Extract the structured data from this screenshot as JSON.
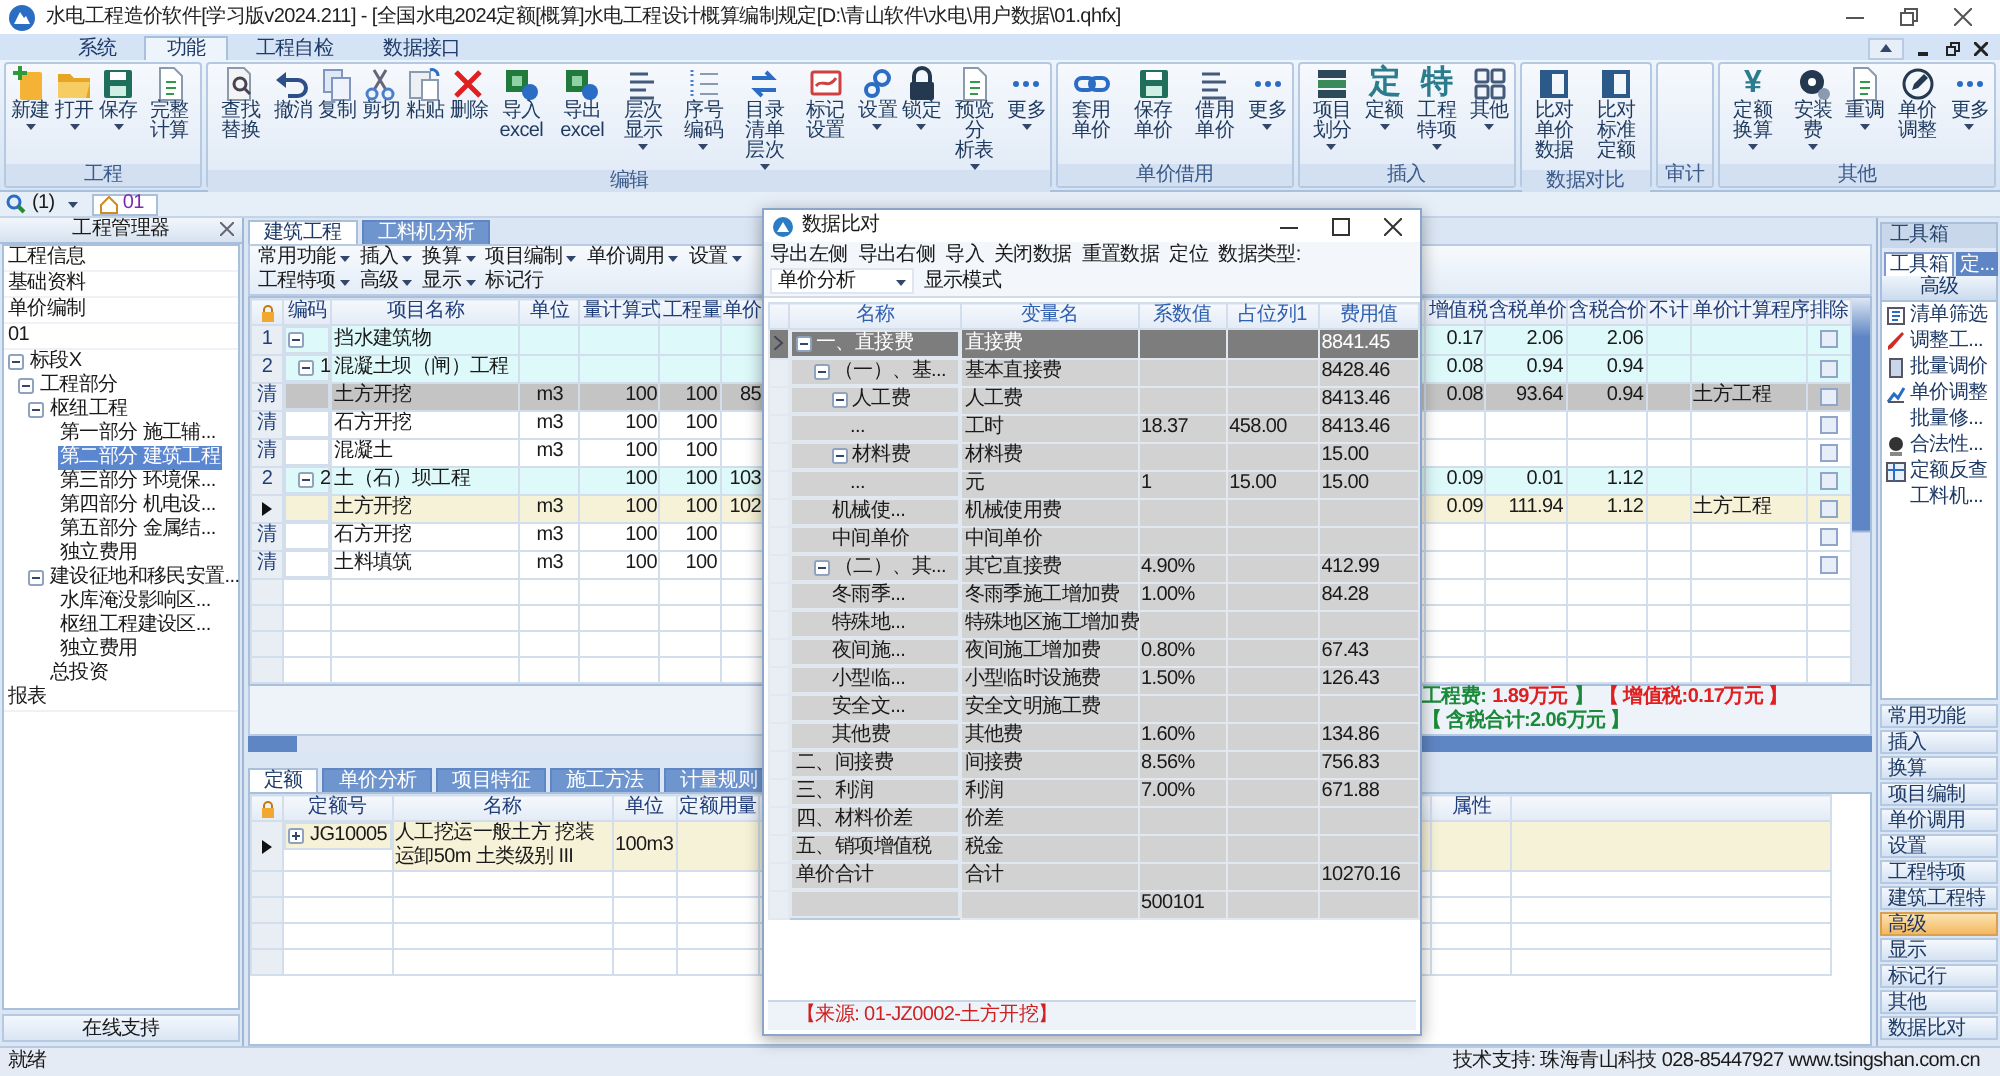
{
  "window": {
    "title": "水电工程造价软件[学习版v2024.211] - [全国水电2024定额[概算]水电工程设计概算编制规定[D:\\青山软件\\水电\\用户数据\\01.qhfx]"
  },
  "menu_tabs": [
    {
      "label": "系统",
      "selected": false
    },
    {
      "label": "功能",
      "selected": true
    },
    {
      "label": "工程自检",
      "selected": false
    },
    {
      "label": "数据接口",
      "selected": false
    }
  ],
  "ribbon_groups": [
    {
      "title": "工程",
      "buttons": [
        {
          "label": "新建",
          "dropdown": true
        },
        {
          "label": "打开",
          "dropdown": true
        },
        {
          "label": "保存",
          "dropdown": true
        },
        {
          "label": "完整计算",
          "dropdown": false
        }
      ]
    },
    {
      "title": "编辑",
      "buttons": [
        {
          "label": "查找替换",
          "dropdown": false
        },
        {
          "label": "撤消",
          "dropdown": false
        },
        {
          "label": "复制",
          "dropdown": false
        },
        {
          "label": "剪切",
          "dropdown": false
        },
        {
          "label": "粘贴",
          "dropdown": false
        },
        {
          "label": "删除",
          "dropdown": false
        },
        {
          "label": "导入excel",
          "dropdown": false
        },
        {
          "label": "导出excel",
          "dropdown": false
        },
        {
          "label": "层次显示",
          "dropdown": true
        },
        {
          "label": "序号编码",
          "dropdown": true
        },
        {
          "label": "目录清单层次",
          "dropdown": true
        },
        {
          "label": "标记设置",
          "dropdown": false
        },
        {
          "label": "设置",
          "dropdown": true
        },
        {
          "label": "锁定",
          "dropdown": true
        },
        {
          "label": "预览分析表",
          "dropdown": true
        },
        {
          "label": "更多",
          "dropdown": true
        }
      ]
    },
    {
      "title": "单价借用",
      "buttons": [
        {
          "label": "套用单价",
          "dropdown": false
        },
        {
          "label": "保存单价",
          "dropdown": false
        },
        {
          "label": "借用单价",
          "dropdown": false
        },
        {
          "label": "更多",
          "dropdown": true
        }
      ]
    },
    {
      "title": "插入",
      "buttons": [
        {
          "label": "项目划分",
          "dropdown": true
        },
        {
          "label": "定额",
          "dropdown": true,
          "glyph": "定"
        },
        {
          "label": "工程特项",
          "dropdown": true,
          "glyph": "特"
        },
        {
          "label": "其他",
          "dropdown": true
        }
      ]
    },
    {
      "title": "数据对比",
      "buttons": [
        {
          "label": "比对单价数据",
          "dropdown": false
        },
        {
          "label": "比对标准定额",
          "dropdown": false
        }
      ]
    },
    {
      "title": "审计"
    },
    {
      "title": "其他",
      "buttons": [
        {
          "label": "定额换算",
          "dropdown": true,
          "glyph": "¥"
        },
        {
          "label": "安装费",
          "dropdown": true
        },
        {
          "label": "重调",
          "dropdown": true
        },
        {
          "label": "单价调整",
          "dropdown": false
        },
        {
          "label": "更多",
          "dropdown": true
        }
      ]
    }
  ],
  "doc_tabs": {
    "search_count": "(1)",
    "tabs": [
      {
        "label": "01",
        "selected": true
      }
    ]
  },
  "manager": {
    "title": "工程管理器",
    "items": [
      {
        "label": "工程信息"
      },
      {
        "label": "基础资料"
      },
      {
        "label": "单价编制"
      },
      {
        "label": "01"
      }
    ],
    "tree": [
      {
        "label": "标段X",
        "selected": false,
        "expanded": true,
        "children": [
          {
            "label": "工程部分",
            "selected": false,
            "expanded": true,
            "children": [
              {
                "label": "枢纽工程",
                "selected": false,
                "expanded": true,
                "children": [
                  {
                    "label": "第一部分 施工辅...",
                    "selected": false
                  },
                  {
                    "label": "第二部分 建筑工程",
                    "selected": true
                  },
                  {
                    "label": "第三部分 环境保...",
                    "selected": false
                  },
                  {
                    "label": "第四部分 机电设...",
                    "selected": false
                  },
                  {
                    "label": "第五部分 金属结...",
                    "selected": false
                  },
                  {
                    "label": "独立费用",
                    "selected": false
                  }
                ]
              },
              {
                "label": "建设征地和移民安置...",
                "selected": false,
                "expanded": true,
                "children": [
                  {
                    "label": "水库淹没影响区...",
                    "selected": false
                  },
                  {
                    "label": "枢纽工程建设区...",
                    "selected": false
                  },
                  {
                    "label": "独立费用",
                    "selected": false
                  }
                ]
              },
              {
                "label": "总投资",
                "selected": false
              }
            ]
          }
        ]
      }
    ],
    "footer_items": [
      {
        "label": "报表"
      }
    ],
    "support_button": "在线支持"
  },
  "center": {
    "tabs": [
      {
        "label": "建筑工程",
        "selected": true
      },
      {
        "label": "工料机分析",
        "selected": false
      }
    ],
    "toolbar": [
      {
        "label": "常用功能",
        "dropdown": true
      },
      {
        "label": "插入",
        "dropdown": true
      },
      {
        "label": "换算",
        "dropdown": true
      },
      {
        "label": "项目编制",
        "dropdown": true
      },
      {
        "label": "单价调用",
        "dropdown": true
      },
      {
        "label": "设置",
        "dropdown": true
      },
      {
        "label": "工程特项",
        "dropdown": true
      },
      {
        "label": "高级",
        "dropdown": true
      },
      {
        "label": "显示",
        "dropdown": true
      },
      {
        "label": "标记行",
        "dropdown": false
      }
    ],
    "table": {
      "columns": [
        "编码",
        "项目名称",
        "单位",
        "量计算式",
        "工程量",
        "单价",
        "增值税",
        "含税单价",
        "含税合价",
        "不计",
        "单价计算程序",
        "排除"
      ],
      "rows": [
        {
          "head": "1",
          "name": "挡水建筑物",
          "vat": "0.17",
          "tax_unit": "2.06",
          "tax_total": "2.06",
          "selected": false,
          "current": false,
          "excluded": false,
          "expanded": true,
          "children": [
            {
              "head": "2",
              "code": "1",
              "name": "混凝土坝（闸）工程",
              "vat": "0.08",
              "tax_unit": "0.94",
              "tax_total": "0.94",
              "selected": false,
              "current": false,
              "excluded": false,
              "expanded": true,
              "children": [
                {
                  "head": "清",
                  "name": "土方开挖",
                  "unit": "m3",
                  "formula": "100",
                  "qty": "100",
                  "price": "85",
                  "vat": "0.08",
                  "tax_unit": "93.64",
                  "tax_total": "0.94",
                  "program": "土方工程",
                  "selected": true,
                  "current": false,
                  "excluded": false
                },
                {
                  "head": "清",
                  "name": "石方开挖",
                  "unit": "m3",
                  "formula": "100",
                  "qty": "100",
                  "selected": false,
                  "current": false,
                  "excluded": false
                },
                {
                  "head": "清",
                  "name": "混凝土",
                  "unit": "m3",
                  "formula": "100",
                  "qty": "100",
                  "selected": false,
                  "current": false,
                  "excluded": false
                }
              ]
            },
            {
              "head": "2",
              "code": "2",
              "name": "土（石）坝工程",
              "formula": "100",
              "qty": "100",
              "price": "103",
              "vat": "0.09",
              "tax_unit": "0.01",
              "tax_total": "1.12",
              "selected": false,
              "current": false,
              "excluded": false,
              "expanded": true,
              "children": [
                {
                  "name": "土方开挖",
                  "unit": "m3",
                  "formula": "100",
                  "qty": "100",
                  "price": "102",
                  "vat": "0.09",
                  "tax_unit": "111.94",
                  "tax_total": "1.12",
                  "program": "土方工程",
                  "selected": false,
                  "current": true,
                  "excluded": false
                },
                {
                  "head": "清",
                  "name": "石方开挖",
                  "unit": "m3",
                  "formula": "100",
                  "qty": "100",
                  "selected": false,
                  "current": false,
                  "excluded": false
                },
                {
                  "head": "清",
                  "name": "土料填筑",
                  "unit": "m3",
                  "formula": "100",
                  "qty": "100",
                  "selected": false,
                  "current": false,
                  "excluded": false
                }
              ]
            }
          ]
        }
      ]
    },
    "summary": [
      {
        "text": "工程费:",
        "color": "#1a8a3a"
      },
      {
        "text": "1.89万元",
        "color": "#e02020"
      },
      {
        "text": "】",
        "color": "#1a8a3a"
      },
      {
        "text": "【 增值税:0.17万元 】",
        "color": "#e02020"
      },
      {
        "text": "【 含税合计:2.06万元 】",
        "color": "#1a8a3a"
      }
    ]
  },
  "bottom": {
    "tabs": [
      {
        "label": "定额",
        "selected": true
      },
      {
        "label": "单价分析",
        "selected": false
      },
      {
        "label": "项目特征",
        "selected": false
      },
      {
        "label": "施工方法",
        "selected": false
      },
      {
        "label": "计量规则",
        "selected": false
      }
    ],
    "table": {
      "columns": [
        "定额号",
        "名称",
        "单位",
        "定额用量",
        "属性"
      ],
      "rows": [
        {
          "code": "JG10005",
          "name": "人工挖运一般土方 挖装运卸50m 土类级别 III",
          "unit": "100m3",
          "current": true,
          "expanded": false
        }
      ]
    }
  },
  "toolbox": {
    "title": "工具箱",
    "tabs": [
      {
        "label": "工具箱",
        "selected": true
      },
      {
        "label": "定...",
        "selected": false
      }
    ],
    "section": "高级",
    "items": [
      "清单筛选",
      "调整工...",
      "批量调价",
      "单价调整",
      "批量修...",
      "合法性...",
      "定额反查",
      "工料机..."
    ],
    "panels": [
      {
        "label": "常用功能",
        "selected": false
      },
      {
        "label": "插入",
        "selected": false
      },
      {
        "label": "换算",
        "selected": false
      },
      {
        "label": "项目编制",
        "selected": false
      },
      {
        "label": "单价调用",
        "selected": false
      },
      {
        "label": "设置",
        "selected": false
      },
      {
        "label": "工程特项",
        "selected": false
      },
      {
        "label": "建筑工程特",
        "selected": false
      },
      {
        "label": "高级",
        "selected": true
      },
      {
        "label": "显示",
        "selected": false
      },
      {
        "label": "标记行",
        "selected": false
      },
      {
        "label": "其他",
        "selected": false
      },
      {
        "label": "数据比对",
        "selected": false
      }
    ]
  },
  "dialog": {
    "title": "数据比对",
    "toolbar": [
      "导出左侧",
      "导出右侧",
      "导入",
      "关闭数据",
      "重置数据",
      "定位"
    ],
    "type_label": "数据类型:",
    "type_value": "单价分析",
    "mode_label": "显示模式",
    "columns": [
      "名称",
      "变量名",
      "系数值",
      "占位列1",
      "费用值"
    ],
    "rows": [
      {
        "name": "一、直接费",
        "var": "直接费",
        "fee": "8841.45",
        "selected": true,
        "expanded": true,
        "children": [
          {
            "name": "（一）、基...",
            "var": "基本直接费",
            "fee": "8428.46",
            "selected": false,
            "expanded": true,
            "children": [
              {
                "name": "人工费",
                "var": "人工费",
                "fee": "8413.46",
                "selected": false,
                "expanded": true,
                "children": [
                  {
                    "name": "...",
                    "var": "工时",
                    "coef": "18.37",
                    "occ": "458.00",
                    "fee": "8413.46",
                    "selected": false
                  }
                ]
              },
              {
                "name": "材料费",
                "var": "材料费",
                "fee": "15.00",
                "selected": false,
                "expanded": true,
                "children": [
                  {
                    "name": "...",
                    "var": "元",
                    "coef": "1",
                    "occ": "15.00",
                    "fee": "15.00",
                    "selected": false
                  }
                ]
              },
              {
                "name": "机械使...",
                "var": "机械使用费",
                "selected": false
              },
              {
                "name": "中间单价",
                "var": "中间单价",
                "selected": false
              }
            ]
          },
          {
            "name": "（二）、其...",
            "var": "其它直接费",
            "coef": "4.90%",
            "fee": "412.99",
            "selected": false,
            "expanded": true,
            "children": [
              {
                "name": "冬雨季...",
                "var": "冬雨季施工增加费",
                "coef": "1.00%",
                "fee": "84.28",
                "selected": false
              },
              {
                "name": "特殊地...",
                "var": "特殊地区施工增加费",
                "selected": false
              },
              {
                "name": "夜间施...",
                "var": "夜间施工增加费",
                "coef": "0.80%",
                "fee": "67.43",
                "selected": false
              },
              {
                "name": "小型临...",
                "var": "小型临时设施费",
                "coef": "1.50%",
                "fee": "126.43",
                "selected": false
              },
              {
                "name": "安全文...",
                "var": "安全文明施工费",
                "selected": false
              },
              {
                "name": "其他费",
                "var": "其他费",
                "coef": "1.60%",
                "fee": "134.86",
                "selected": false
              }
            ]
          }
        ]
      },
      {
        "name": "二、间接费",
        "var": "间接费",
        "coef": "8.56%",
        "fee": "756.83",
        "selected": false
      },
      {
        "name": "三、利润",
        "var": "利润",
        "coef": "7.00%",
        "fee": "671.88",
        "selected": false
      },
      {
        "name": "四、材料价差",
        "var": "价差",
        "selected": false
      },
      {
        "name": "五、销项增值税",
        "var": "税金",
        "selected": false
      },
      {
        "name": "单价合计",
        "var": "合计",
        "fee": "10270.16",
        "selected": false
      },
      {
        "coef": "500101",
        "selected": false
      }
    ],
    "source": "【来源: 01-JZ0002-土方开挖】"
  },
  "status_bar": {
    "text": "就绪",
    "support": "技术支持: 珠海青山科技 028-85447927 www.tsingshan.com.cn"
  }
}
